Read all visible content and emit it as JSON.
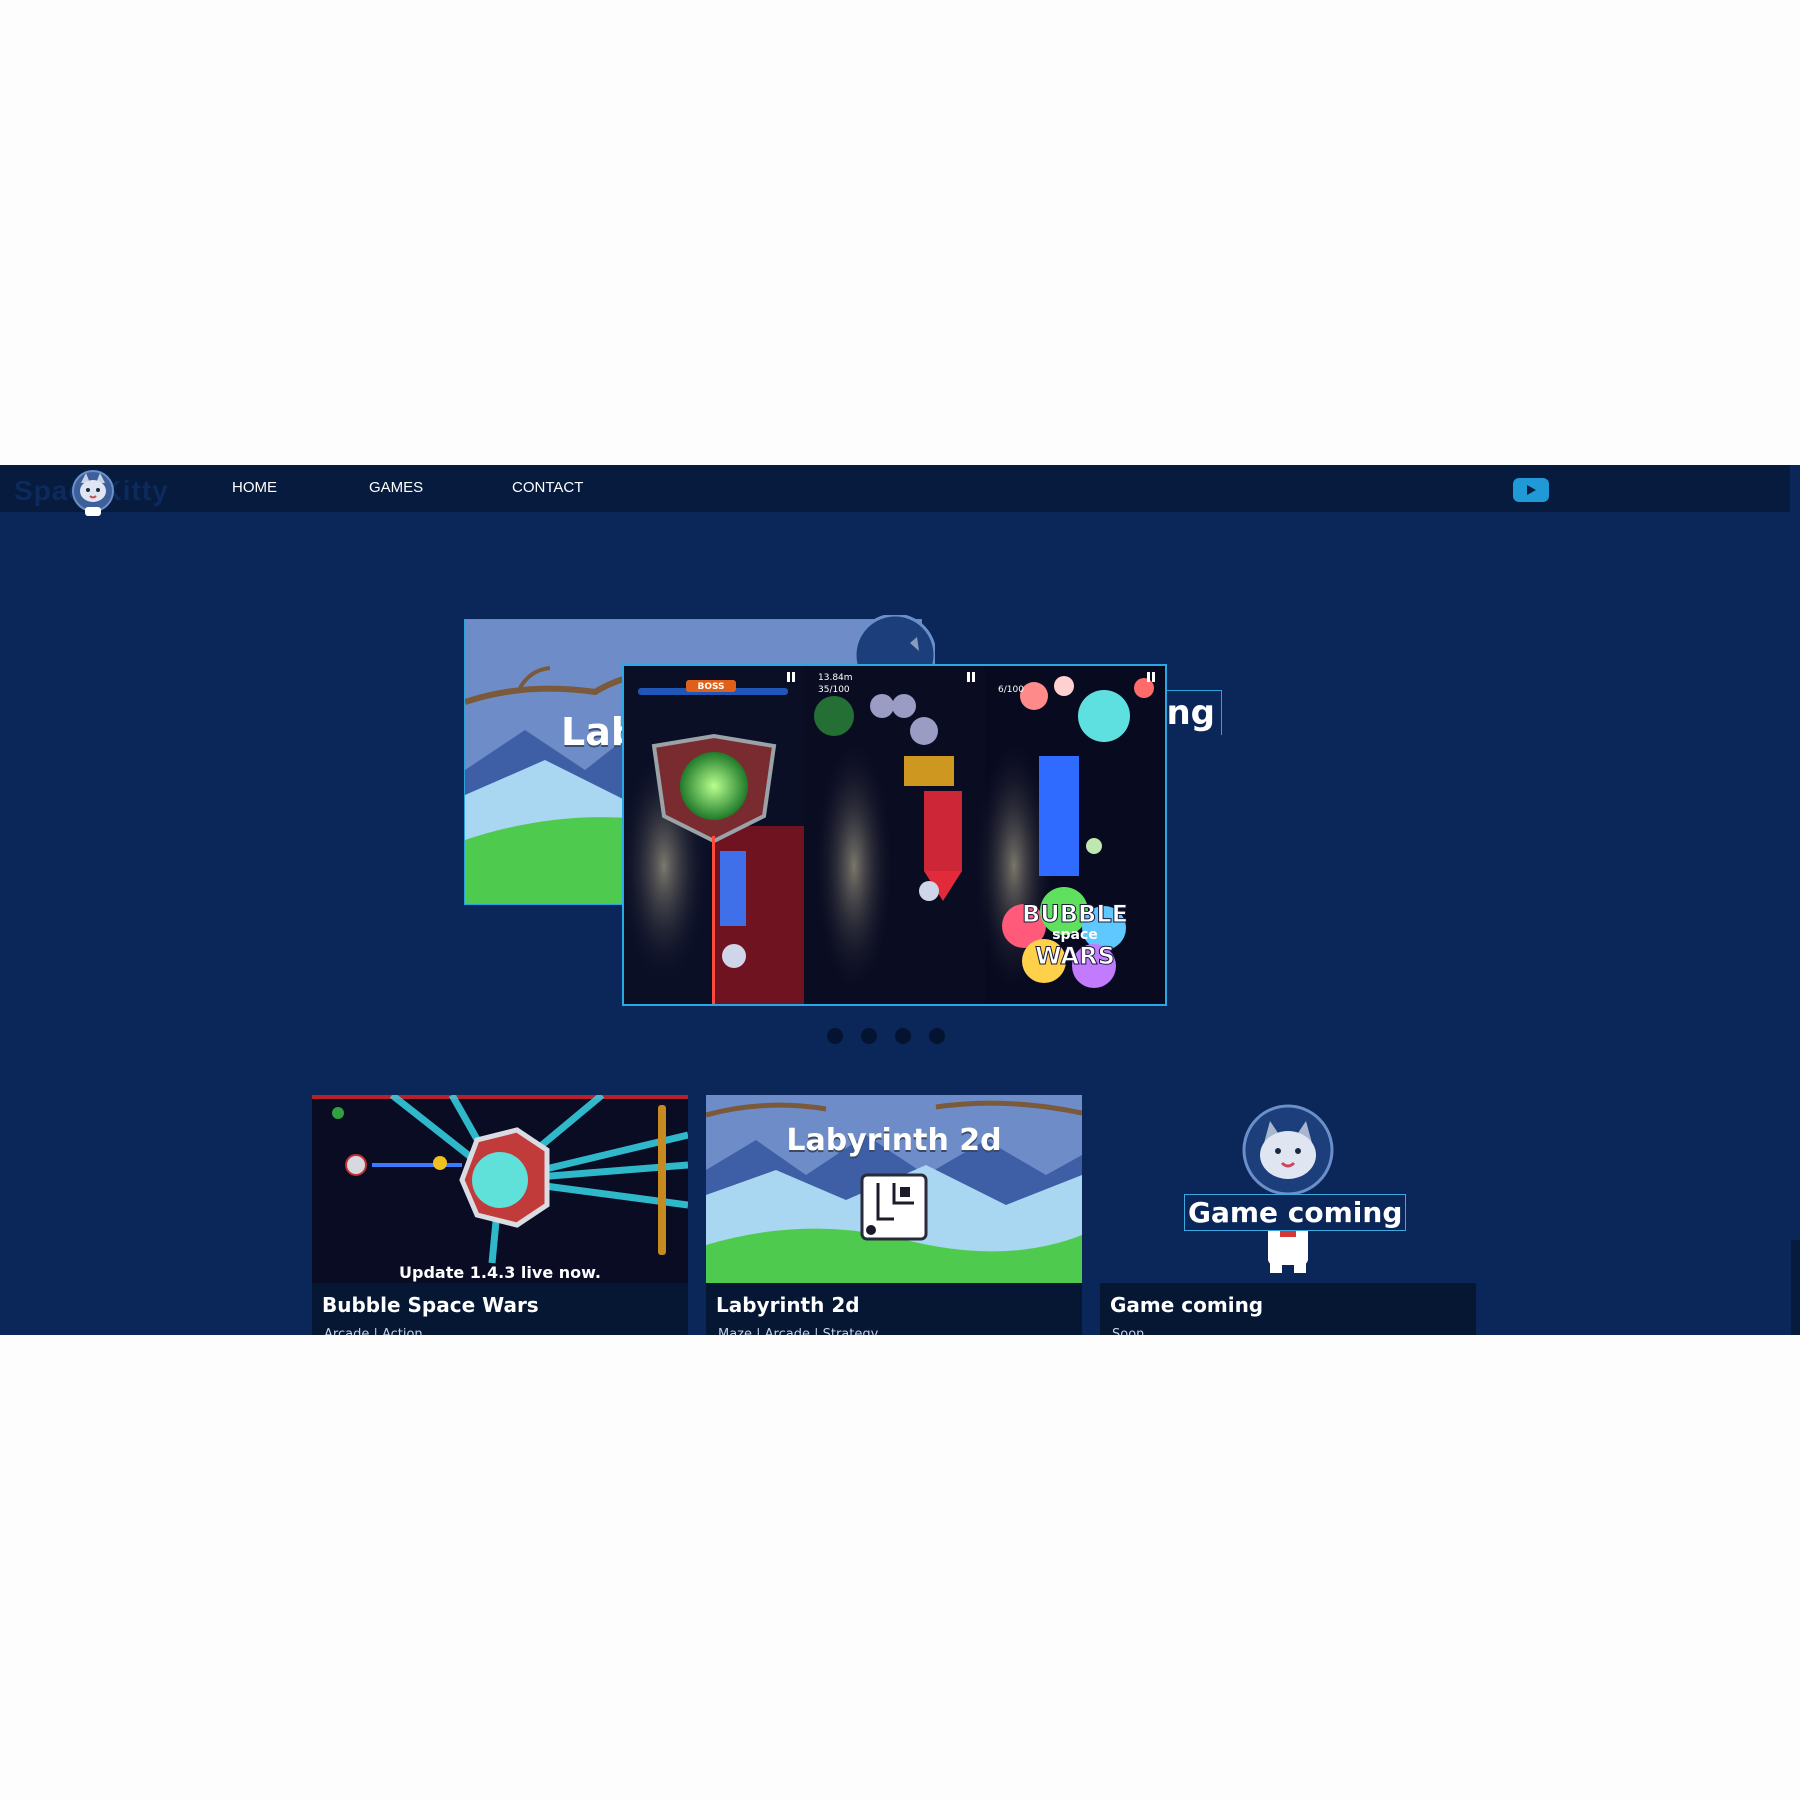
{
  "site": {
    "logo_text": "SpaceKitty"
  },
  "nav": {
    "items": [
      "HOME",
      "GAMES",
      "CONTACT"
    ]
  },
  "social": {
    "icon": "youtube-play-icon",
    "color": "#1f9ad6"
  },
  "carousel": {
    "slides": [
      {
        "label": "Lab"
      },
      {
        "label": "ing"
      },
      {
        "boss_label": "BOSS",
        "stat1": "13.84m",
        "stat2": "35/100",
        "stat3": "6/100",
        "logo_line1": "BUBBLE",
        "logo_line2": "space",
        "logo_line3": "WARS"
      }
    ],
    "dot_count": 4
  },
  "cards": [
    {
      "title": "Bubble Space Wars",
      "caption": "Update 1.4.3 live now.",
      "subtitle": "Arcade | Action"
    },
    {
      "title": "Labyrinth 2d",
      "thumb_title": "Labyrinth 2d",
      "subtitle": "Maze | Arcade | Strategy"
    },
    {
      "title": "Game coming",
      "thumb_title": "Game coming",
      "subtitle": "Soon"
    }
  ],
  "colors": {
    "page_bg": "#0b2658",
    "nav_bg": "#061b3d",
    "card_info_bg": "#051733",
    "accent": "#28a9e6"
  }
}
